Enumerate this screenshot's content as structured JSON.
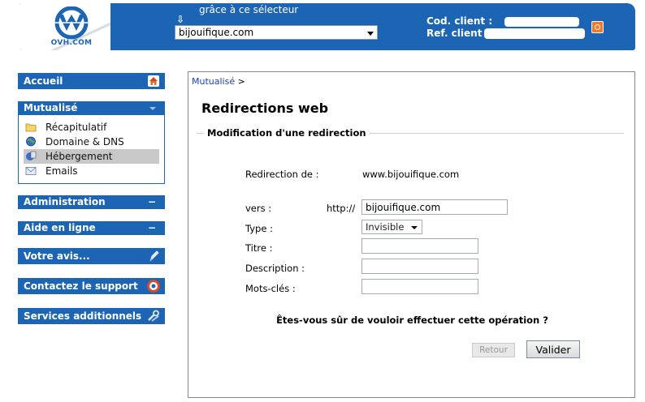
{
  "header": {
    "logo_text": "OVH.COM",
    "selector_caption": "grâce à ce sélecteur",
    "domain_selected": "bijouifique.com",
    "client_code_label": "Cod. client :",
    "client_ref_label": "Ref. client",
    "brand_color": "#1c64b4"
  },
  "sidebar": {
    "home": "Accueil",
    "hosting_group": {
      "label": "Mutualisé",
      "items": [
        {
          "label": "Récapitulatif",
          "icon": "folder-icon"
        },
        {
          "label": "Domaine & DNS",
          "icon": "globe-icon"
        },
        {
          "label": "Hébergement",
          "icon": "server-icon",
          "active": true
        },
        {
          "label": "Emails",
          "icon": "envelope-icon"
        }
      ]
    },
    "administration": "Administration",
    "help": "Aide en ligne",
    "feedback": "Votre avis...",
    "support": "Contactez le support",
    "extra_services": "Services additionnels"
  },
  "main": {
    "breadcrumb": "Mutualisé",
    "breadcrumb_sep": ">",
    "title": "Redirections web",
    "section_title": "Modification d'une redirection",
    "form": {
      "redirect_from_label": "Redirection de :",
      "redirect_from_value": "www.bijouifique.com",
      "to_label": "vers :",
      "to_prefix": "http://",
      "to_value": "bijouifique.com",
      "type_label": "Type :",
      "type_value": "Invisible",
      "title_label": "Titre :",
      "title_value": "",
      "description_label": "Description :",
      "description_value": "",
      "keywords_label": "Mots-clés :",
      "keywords_value": ""
    },
    "confirm_text": "Êtes-vous sûr de vouloir effectuer cette opération ?",
    "back_button": "Retour",
    "submit_button": "Valider"
  }
}
